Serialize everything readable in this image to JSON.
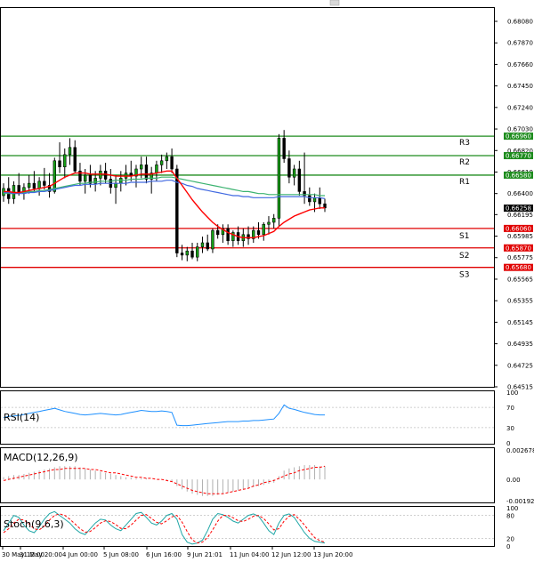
{
  "chart_data": {
    "type": "candlestick",
    "main": {
      "ylim": [
        0.64515,
        0.6808
      ],
      "yticks": [
        "0.68080",
        "0.67870",
        "0.67660",
        "0.67450",
        "0.67240",
        "0.67030",
        "0.66820",
        "0.66610",
        "0.66400",
        "0.66195",
        "0.65985",
        "0.65775",
        "0.65565",
        "0.65355",
        "0.65145",
        "0.64935",
        "0.64725",
        "0.64515"
      ],
      "last_price": "0.66258",
      "levels": [
        {
          "name": "R3",
          "value": 0.6696,
          "label": "0.66960",
          "color": "#1e8c1e"
        },
        {
          "name": "R2",
          "value": 0.6677,
          "label": "0.66770",
          "color": "#1e8c1e"
        },
        {
          "name": "R1",
          "value": 0.6658,
          "label": "0.66580",
          "color": "#1e8c1e"
        },
        {
          "name": "S1",
          "value": 0.6606,
          "label": "0.66060",
          "color": "#e00000"
        },
        {
          "name": "S2",
          "value": 0.6587,
          "label": "0.65870",
          "color": "#e00000"
        },
        {
          "name": "S3",
          "value": 0.6568,
          "label": "0.65680",
          "color": "#e00000"
        }
      ],
      "candles": [
        [
          0.6638,
          0.665,
          0.6632,
          0.6645
        ],
        [
          0.6645,
          0.6656,
          0.663,
          0.6635
        ],
        [
          0.6635,
          0.6652,
          0.663,
          0.6648
        ],
        [
          0.6648,
          0.666,
          0.6638,
          0.664
        ],
        [
          0.664,
          0.665,
          0.6634,
          0.6646
        ],
        [
          0.6646,
          0.6658,
          0.664,
          0.665
        ],
        [
          0.665,
          0.6662,
          0.6642,
          0.6645
        ],
        [
          0.6645,
          0.6656,
          0.6638,
          0.6652
        ],
        [
          0.6652,
          0.6665,
          0.6644,
          0.6648
        ],
        [
          0.6648,
          0.666,
          0.6636,
          0.6642
        ],
        [
          0.6642,
          0.6675,
          0.664,
          0.6672
        ],
        [
          0.6672,
          0.669,
          0.666,
          0.6666
        ],
        [
          0.6666,
          0.6684,
          0.6655,
          0.6678
        ],
        [
          0.6678,
          0.6694,
          0.6668,
          0.6685
        ],
        [
          0.6685,
          0.6692,
          0.666,
          0.6662
        ],
        [
          0.6662,
          0.667,
          0.6648,
          0.6652
        ],
        [
          0.6652,
          0.6664,
          0.664,
          0.6658
        ],
        [
          0.6658,
          0.6668,
          0.6646,
          0.665
        ],
        [
          0.665,
          0.6662,
          0.6642,
          0.6655
        ],
        [
          0.6655,
          0.6668,
          0.6648,
          0.6662
        ],
        [
          0.6662,
          0.667,
          0.665,
          0.6654
        ],
        [
          0.6654,
          0.6664,
          0.664,
          0.6646
        ],
        [
          0.6646,
          0.6658,
          0.663,
          0.665
        ],
        [
          0.665,
          0.6662,
          0.6642,
          0.6655
        ],
        [
          0.6655,
          0.6668,
          0.6648,
          0.666
        ],
        [
          0.666,
          0.6672,
          0.6652,
          0.6657
        ],
        [
          0.6657,
          0.6668,
          0.6646,
          0.6664
        ],
        [
          0.6664,
          0.6676,
          0.6655,
          0.6668
        ],
        [
          0.6668,
          0.6676,
          0.665,
          0.6654
        ],
        [
          0.6654,
          0.6666,
          0.664,
          0.666
        ],
        [
          0.666,
          0.6672,
          0.6652,
          0.6668
        ],
        [
          0.6668,
          0.6678,
          0.666,
          0.6672
        ],
        [
          0.6672,
          0.668,
          0.6664,
          0.6676
        ],
        [
          0.6676,
          0.6684,
          0.666,
          0.6664
        ],
        [
          0.6664,
          0.6668,
          0.6578,
          0.6582
        ],
        [
          0.6582,
          0.659,
          0.6575,
          0.658
        ],
        [
          0.658,
          0.6588,
          0.6574,
          0.6584
        ],
        [
          0.6584,
          0.6592,
          0.6576,
          0.6578
        ],
        [
          0.6578,
          0.6592,
          0.6574,
          0.6588
        ],
        [
          0.6588,
          0.6598,
          0.6582,
          0.6592
        ],
        [
          0.6592,
          0.66,
          0.6584,
          0.6586
        ],
        [
          0.6586,
          0.6606,
          0.6582,
          0.6604
        ],
        [
          0.6604,
          0.661,
          0.6596,
          0.66
        ],
        [
          0.66,
          0.661,
          0.6592,
          0.6606
        ],
        [
          0.6606,
          0.661,
          0.659,
          0.6594
        ],
        [
          0.6594,
          0.6604,
          0.6588,
          0.6602
        ],
        [
          0.6602,
          0.6608,
          0.659,
          0.6594
        ],
        [
          0.6594,
          0.6606,
          0.6588,
          0.66
        ],
        [
          0.66,
          0.6608,
          0.659,
          0.6596
        ],
        [
          0.6596,
          0.6608,
          0.6592,
          0.6604
        ],
        [
          0.6604,
          0.6612,
          0.6596,
          0.66
        ],
        [
          0.66,
          0.6612,
          0.6594,
          0.661
        ],
        [
          0.661,
          0.6618,
          0.66,
          0.6612
        ],
        [
          0.6612,
          0.662,
          0.6606,
          0.6616
        ],
        [
          0.6616,
          0.6698,
          0.6608,
          0.6694
        ],
        [
          0.6694,
          0.6702,
          0.667,
          0.6674
        ],
        [
          0.6674,
          0.6682,
          0.665,
          0.6656
        ],
        [
          0.6656,
          0.6668,
          0.6648,
          0.6664
        ],
        [
          0.6664,
          0.6672,
          0.6638,
          0.6642
        ],
        [
          0.6642,
          0.668,
          0.663,
          0.6638
        ],
        [
          0.6638,
          0.6646,
          0.6628,
          0.6632
        ],
        [
          0.6632,
          0.664,
          0.6622,
          0.6636
        ],
        [
          0.6636,
          0.6646,
          0.6625,
          0.663
        ],
        [
          0.663,
          0.6635,
          0.6622,
          0.6626
        ]
      ],
      "sma_red": [
        0.6642,
        0.6642,
        0.6641,
        0.6641,
        0.6642,
        0.6643,
        0.6644,
        0.6645,
        0.6646,
        0.6647,
        0.665,
        0.6653,
        0.6656,
        0.6658,
        0.666,
        0.666,
        0.666,
        0.6659,
        0.6659,
        0.6659,
        0.6659,
        0.6658,
        0.6657,
        0.6657,
        0.6657,
        0.6657,
        0.6658,
        0.6659,
        0.6659,
        0.6659,
        0.666,
        0.6661,
        0.6662,
        0.6662,
        0.6655,
        0.6648,
        0.6641,
        0.6634,
        0.6628,
        0.6622,
        0.6617,
        0.6612,
        0.6608,
        0.6605,
        0.6602,
        0.66,
        0.6598,
        0.6597,
        0.6597,
        0.6597,
        0.6598,
        0.6599,
        0.6601,
        0.6603,
        0.6608,
        0.6612,
        0.6615,
        0.6618,
        0.662,
        0.6622,
        0.6624,
        0.6625,
        0.6626,
        0.6626
      ],
      "ma_green": [
        0.664,
        0.664,
        0.664,
        0.6641,
        0.6641,
        0.6642,
        0.6642,
        0.6643,
        0.6643,
        0.6644,
        0.6645,
        0.6646,
        0.6647,
        0.6648,
        0.6649,
        0.665,
        0.665,
        0.6651,
        0.6651,
        0.6652,
        0.6652,
        0.6652,
        0.6653,
        0.6653,
        0.6653,
        0.6654,
        0.6654,
        0.6654,
        0.6655,
        0.6655,
        0.6655,
        0.6656,
        0.6656,
        0.6656,
        0.6655,
        0.6654,
        0.6653,
        0.6652,
        0.6651,
        0.665,
        0.6649,
        0.6648,
        0.6647,
        0.6646,
        0.6645,
        0.6644,
        0.6643,
        0.6642,
        0.6642,
        0.6641,
        0.664,
        0.664,
        0.6639,
        0.6639,
        0.6639,
        0.6639,
        0.6639,
        0.6639,
        0.6639,
        0.6639,
        0.6639,
        0.6639,
        0.6638,
        0.6638
      ],
      "ma_blue": [
        0.6641,
        0.6641,
        0.664,
        0.664,
        0.664,
        0.6641,
        0.6641,
        0.6642,
        0.6642,
        0.6643,
        0.6644,
        0.6645,
        0.6646,
        0.6647,
        0.6648,
        0.6648,
        0.6649,
        0.6649,
        0.6649,
        0.665,
        0.665,
        0.665,
        0.665,
        0.665,
        0.665,
        0.6651,
        0.6651,
        0.6651,
        0.6651,
        0.6652,
        0.6652,
        0.6652,
        0.6653,
        0.6653,
        0.6651,
        0.665,
        0.6648,
        0.6647,
        0.6645,
        0.6644,
        0.6643,
        0.6642,
        0.6641,
        0.664,
        0.6639,
        0.6638,
        0.6638,
        0.6637,
        0.6637,
        0.6636,
        0.6636,
        0.6636,
        0.6636,
        0.6636,
        0.6637,
        0.6637,
        0.6637,
        0.6637,
        0.6637,
        0.6637,
        0.6636,
        0.6636,
        0.6636,
        0.6635
      ]
    },
    "rsi": {
      "title": "RSI(14)",
      "ylim": [
        0,
        100
      ],
      "yticks": [
        "100",
        "70",
        "30",
        "0"
      ],
      "levels": [
        70,
        30
      ],
      "values": [
        50,
        52,
        53,
        54,
        56,
        58,
        60,
        62,
        64,
        66,
        68,
        65,
        62,
        60,
        58,
        56,
        55,
        56,
        57,
        58,
        57,
        56,
        55,
        56,
        58,
        60,
        62,
        64,
        63,
        62,
        62,
        63,
        62,
        60,
        35,
        34,
        34,
        35,
        36,
        37,
        38,
        39,
        40,
        41,
        42,
        42,
        42,
        43,
        43,
        44,
        44,
        45,
        46,
        47,
        58,
        75,
        68,
        66,
        63,
        60,
        58,
        56,
        55,
        55
      ]
    },
    "macd": {
      "title": "MACD(12,26,9)",
      "yticks": [
        "0.002678",
        "0.00",
        "-0.001927"
      ],
      "ylim": [
        -0.001927,
        0.002678
      ],
      "histogram": [
        0.0002,
        0.0003,
        0.0004,
        0.0004,
        0.0005,
        0.0006,
        0.0007,
        0.0008,
        0.0009,
        0.001,
        0.0011,
        0.0012,
        0.0012,
        0.0012,
        0.0012,
        0.0011,
        0.001,
        0.0009,
        0.0008,
        0.0007,
        0.0006,
        0.0005,
        0.0004,
        0.0003,
        0.0002,
        0.0002,
        0.0001,
        0.0001,
        0.0001,
        0.0,
        0.0,
        0.0,
        -0.0001,
        -0.0002,
        -0.0006,
        -0.0009,
        -0.0011,
        -0.0013,
        -0.0014,
        -0.0015,
        -0.0015,
        -0.0015,
        -0.0014,
        -0.0013,
        -0.0012,
        -0.0011,
        -0.001,
        -0.0009,
        -0.0008,
        -0.0007,
        -0.0006,
        -0.0005,
        -0.0004,
        -0.0003,
        0.0003,
        0.0008,
        0.001,
        0.0011,
        0.0012,
        0.0013,
        0.0013,
        0.0013,
        0.0012,
        0.0012
      ],
      "signal": [
        -0.0001,
        0.0,
        0.0001,
        0.0002,
        0.0003,
        0.0004,
        0.0005,
        0.0006,
        0.0007,
        0.0008,
        0.0009,
        0.0009,
        0.001,
        0.001,
        0.001,
        0.001,
        0.001,
        0.0009,
        0.0009,
        0.0008,
        0.0007,
        0.0006,
        0.0006,
        0.0005,
        0.0004,
        0.0003,
        0.0002,
        0.0002,
        0.0001,
        0.0001,
        0.0,
        0.0,
        -0.0001,
        -0.0002,
        -0.0004,
        -0.0006,
        -0.0008,
        -0.001,
        -0.0011,
        -0.0012,
        -0.0013,
        -0.0013,
        -0.0013,
        -0.0013,
        -0.0012,
        -0.0011,
        -0.001,
        -0.0009,
        -0.0008,
        -0.0006,
        -0.0005,
        -0.0003,
        -0.0002,
        -0.0001,
        0.0001,
        0.0003,
        0.0005,
        0.0006,
        0.0008,
        0.0009,
        0.001,
        0.0011,
        0.0011,
        0.0012
      ]
    },
    "stoch": {
      "title": "Stoch(9,6,3)",
      "ylim": [
        0,
        100
      ],
      "yticks": [
        "100",
        "80",
        "20",
        "0"
      ],
      "levels": [
        80,
        20
      ],
      "main": [
        40,
        60,
        80,
        75,
        55,
        40,
        35,
        50,
        70,
        85,
        90,
        80,
        70,
        60,
        45,
        35,
        30,
        45,
        60,
        70,
        68,
        55,
        45,
        40,
        55,
        70,
        85,
        88,
        75,
        60,
        55,
        65,
        80,
        85,
        70,
        30,
        10,
        5,
        8,
        15,
        40,
        70,
        85,
        82,
        75,
        65,
        60,
        70,
        80,
        84,
        78,
        60,
        40,
        30,
        60,
        80,
        84,
        75,
        55,
        35,
        20,
        12,
        10,
        8
      ],
      "signal": [
        35,
        45,
        60,
        70,
        68,
        58,
        45,
        42,
        52,
        68,
        80,
        84,
        80,
        70,
        58,
        45,
        36,
        38,
        48,
        60,
        66,
        64,
        56,
        46,
        45,
        55,
        68,
        80,
        82,
        72,
        62,
        58,
        66,
        76,
        80,
        62,
        38,
        16,
        8,
        10,
        22,
        42,
        65,
        80,
        80,
        74,
        66,
        64,
        70,
        78,
        80,
        72,
        58,
        42,
        45,
        65,
        78,
        82,
        70,
        55,
        38,
        22,
        14,
        10
      ]
    },
    "x_labels": [
      "30 May 12:00",
      "31 May 20:00",
      "4 Jun 00:00",
      "5 Jun 08:00",
      "6 Jun 16:00",
      "9 Jun 21:01",
      "11 Jun 04:00",
      "12 Jun 12:00",
      "13 Jun 20:00"
    ]
  }
}
